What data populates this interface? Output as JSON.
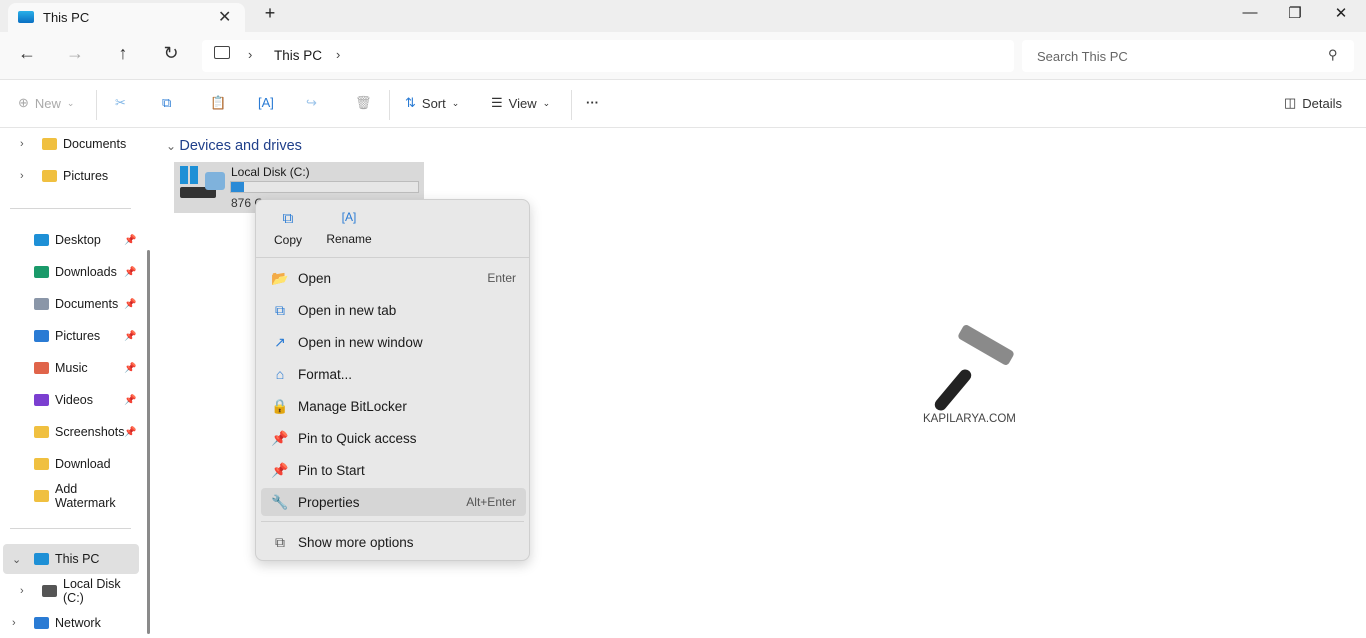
{
  "tab": {
    "title": "This PC"
  },
  "address": {
    "crumb": "This PC",
    "search_placeholder": "Search This PC"
  },
  "toolbar": {
    "new": "New",
    "sort": "Sort",
    "view": "View",
    "details": "Details"
  },
  "sidebar": {
    "top": [
      {
        "label": "Documents"
      },
      {
        "label": "Pictures"
      }
    ],
    "pinned": [
      {
        "label": "Desktop",
        "color": "#1e90d6",
        "pin": true
      },
      {
        "label": "Downloads",
        "color": "#1a9a6a",
        "pin": true
      },
      {
        "label": "Documents",
        "color": "#8a96a8",
        "pin": true
      },
      {
        "label": "Pictures",
        "color": "#2a7bd4",
        "pin": true
      },
      {
        "label": "Music",
        "color": "#e0644a",
        "pin": true
      },
      {
        "label": "Videos",
        "color": "#7b3fd0",
        "pin": true
      },
      {
        "label": "Screenshots",
        "color": "#f0c040",
        "pin": true
      },
      {
        "label": "Download",
        "color": "#f0c040",
        "pin": false
      },
      {
        "label": "Add Watermark",
        "color": "#f0c040",
        "pin": false
      }
    ],
    "this_pc": "This PC",
    "local_disk": "Local Disk (C:)",
    "network": "Network"
  },
  "main": {
    "section": "Devices and drives",
    "drive": {
      "name": "Local Disk (C:)",
      "free": "876 G",
      "used_fraction": 0.07
    }
  },
  "context_menu": {
    "top": [
      {
        "label": "Copy",
        "icon": "copy-icon"
      },
      {
        "label": "Rename",
        "icon": "rename-icon"
      }
    ],
    "items": [
      {
        "label": "Open",
        "shortcut": "Enter",
        "icon": "📂"
      },
      {
        "label": "Open in new tab",
        "shortcut": "",
        "icon": "⧉"
      },
      {
        "label": "Open in new window",
        "shortcut": "",
        "icon": "↗"
      },
      {
        "label": "Format...",
        "shortcut": "",
        "icon": "⌂"
      },
      {
        "label": "Manage BitLocker",
        "shortcut": "",
        "icon": "🔒"
      },
      {
        "label": "Pin to Quick access",
        "shortcut": "",
        "icon": "📌"
      },
      {
        "label": "Pin to Start",
        "shortcut": "",
        "icon": "📌"
      },
      {
        "label": "Properties",
        "shortcut": "Alt+Enter",
        "icon": "🔧"
      }
    ],
    "more": "Show more options"
  },
  "watermark": "KAPILARYA.COM"
}
